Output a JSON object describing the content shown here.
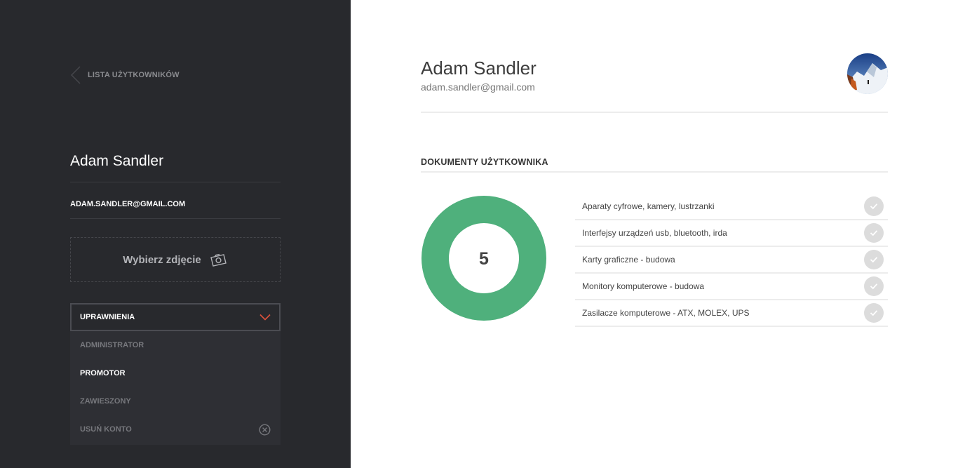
{
  "sidebar": {
    "back_label": "LISTA UŻYTKOWNIKÓW",
    "user_name": "Adam Sandler",
    "user_email": "ADAM.SANDLER@GMAIL.COM",
    "photo_label": "Wybierz zdjęcie",
    "permissions": {
      "label": "UPRAWNIENIA",
      "options": [
        {
          "label": "ADMINISTRATOR",
          "state": "inactive"
        },
        {
          "label": "PROMOTOR",
          "state": "selected"
        },
        {
          "label": "ZAWIESZONY",
          "state": "inactive"
        },
        {
          "label": "USUŃ KONTO",
          "state": "inactive",
          "icon": "close-circle-icon"
        }
      ]
    }
  },
  "main": {
    "user_name": "Adam Sandler",
    "user_email": "adam.sandler@gmail.com",
    "documents_title": "DOKUMENTY UŻYTKOWNIKA",
    "documents_count": "5",
    "documents": [
      {
        "name": "Aparaty cyfrowe, kamery, lustrzanki"
      },
      {
        "name": "Interfejsy urządzeń usb, bluetooth, irda"
      },
      {
        "name": "Karty graficzne - budowa"
      },
      {
        "name": "Monitory komputerowe - budowa"
      },
      {
        "name": "Zasilacze komputerowe - ATX, MOLEX, UPS"
      }
    ]
  },
  "colors": {
    "sidebar_bg": "#28292d",
    "accent_red": "#e0523c",
    "donut_green": "#4fb07c",
    "check_gray": "#dcdcdc"
  }
}
